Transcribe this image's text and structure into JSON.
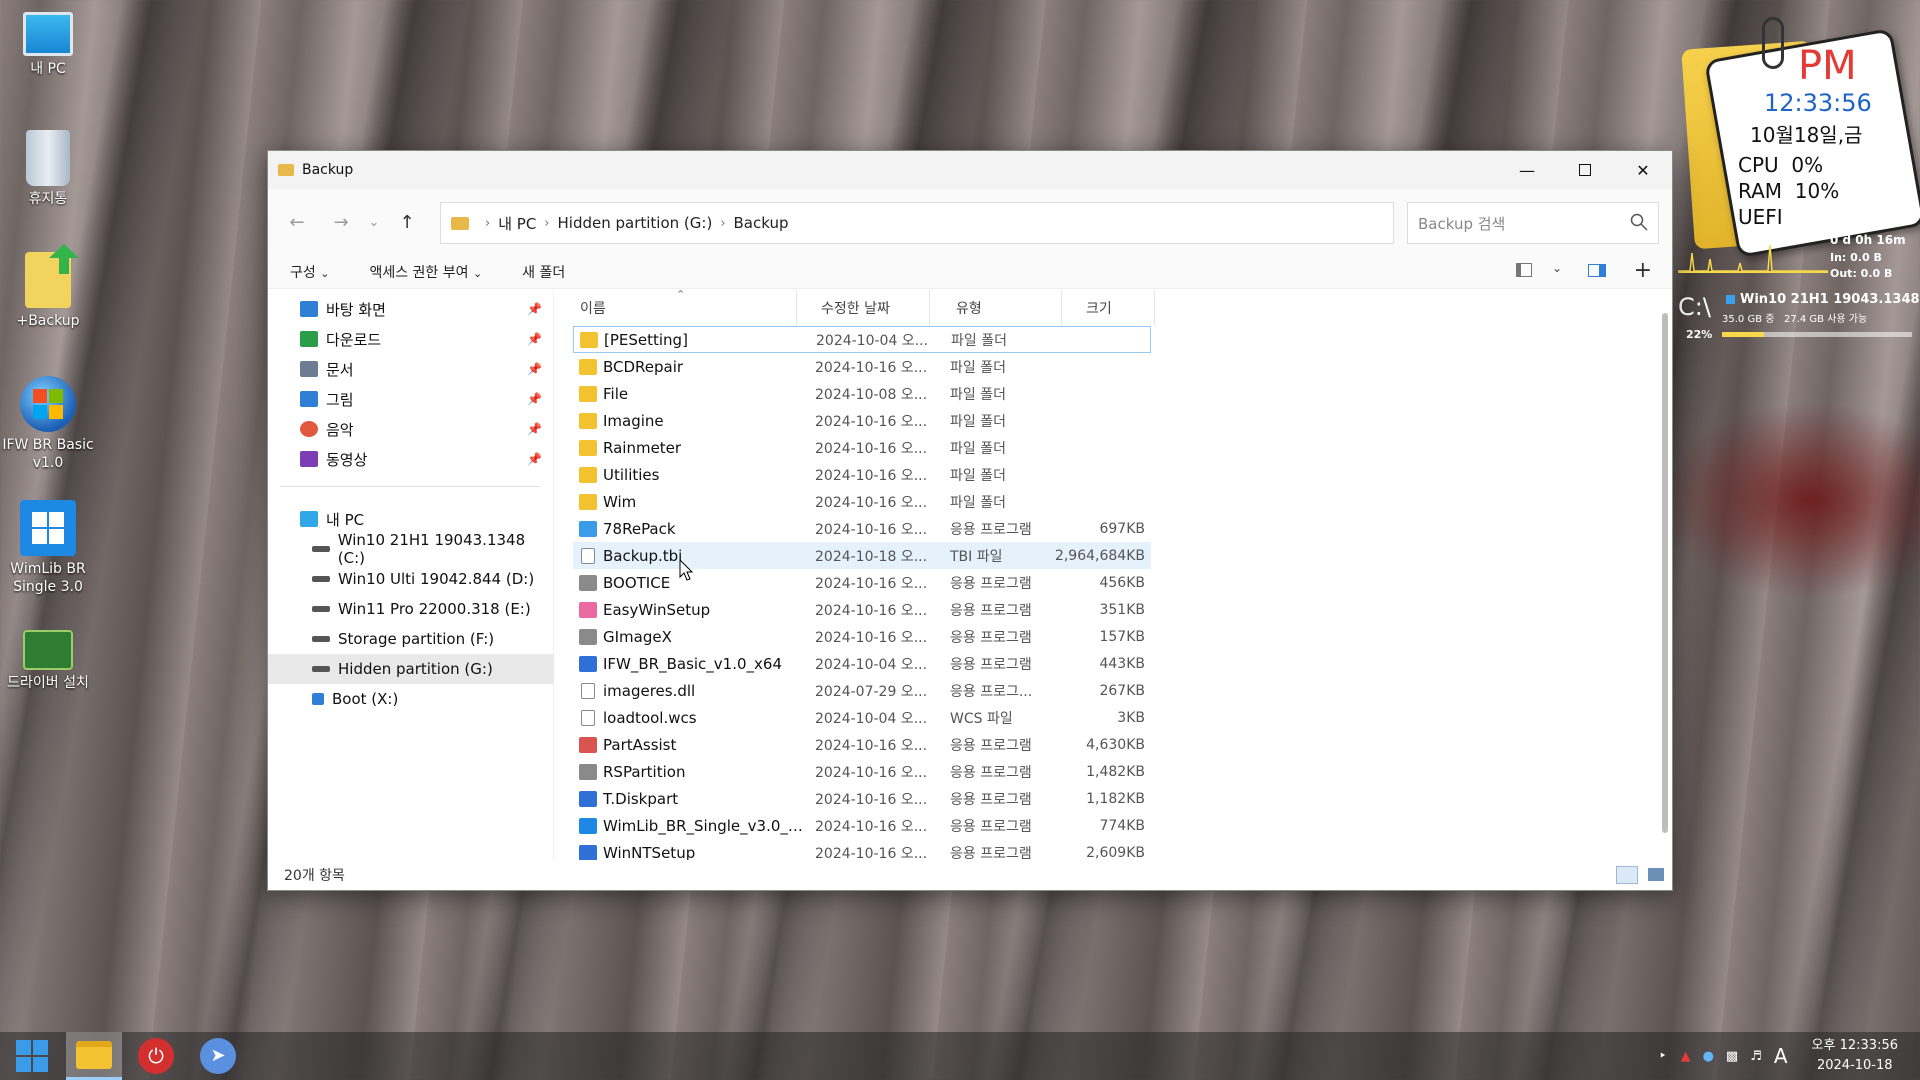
{
  "desktop": {
    "icons": [
      {
        "label": "내 PC"
      },
      {
        "label": "휴지통"
      },
      {
        "label": "+Backup"
      },
      {
        "label": "IFW BR Basic v1.0"
      },
      {
        "label": "WimLib BR Single 3.0"
      },
      {
        "label": "드라이버 설치"
      }
    ]
  },
  "window": {
    "title": "Backup",
    "breadcrumb": [
      "내 PC",
      "Hidden partition (G:)",
      "Backup"
    ],
    "search_placeholder": "Backup 검색",
    "commands": {
      "organize": "구성",
      "share": "액세스 권한 부여",
      "new_folder": "새 폴더"
    },
    "nav": {
      "quick": [
        {
          "label": "바탕 화면",
          "color": "#2f7fd6"
        },
        {
          "label": "다운로드",
          "color": "#2a9d4b"
        },
        {
          "label": "문서",
          "color": "#6b7c93"
        },
        {
          "label": "그림",
          "color": "#2f7fd6"
        },
        {
          "label": "음악",
          "color": "#e0583e"
        },
        {
          "label": "동영상",
          "color": "#7b3fb3"
        }
      ],
      "thispc": "내 PC",
      "drives": [
        "Win10 21H1 19043.1348 (C:)",
        "Win10 Ulti 19042.844 (D:)",
        "Win11 Pro 22000.318 (E:)",
        "Storage partition (F:)",
        "Hidden partition (G:)",
        "Boot (X:)"
      ]
    },
    "columns": {
      "name": "이름",
      "date": "수정한 날짜",
      "type": "유형",
      "size": "크기"
    },
    "files": [
      {
        "name": "[PESetting]",
        "date": "2024-10-04 오...",
        "type": "파일 폴더",
        "size": "",
        "icon": "folder"
      },
      {
        "name": "BCDRepair",
        "date": "2024-10-16 오...",
        "type": "파일 폴더",
        "size": "",
        "icon": "folder"
      },
      {
        "name": "File",
        "date": "2024-10-08 오...",
        "type": "파일 폴더",
        "size": "",
        "icon": "folder"
      },
      {
        "name": "Imagine",
        "date": "2024-10-16 오...",
        "type": "파일 폴더",
        "size": "",
        "icon": "folder"
      },
      {
        "name": "Rainmeter",
        "date": "2024-10-16 오...",
        "type": "파일 폴더",
        "size": "",
        "icon": "folder"
      },
      {
        "name": "Utilities",
        "date": "2024-10-16 오...",
        "type": "파일 폴더",
        "size": "",
        "icon": "folder"
      },
      {
        "name": "Wim",
        "date": "2024-10-16 오...",
        "type": "파일 폴더",
        "size": "",
        "icon": "folder"
      },
      {
        "name": "78RePack",
        "date": "2024-10-16 오...",
        "type": "응용 프로그램",
        "size": "697KB",
        "icon": "app-tri"
      },
      {
        "name": "Backup.tbi",
        "date": "2024-10-18 오...",
        "type": "TBI 파일",
        "size": "2,964,684KB",
        "icon": "file"
      },
      {
        "name": "BOOTICE",
        "date": "2024-10-16 오...",
        "type": "응용 프로그램",
        "size": "456KB",
        "icon": "app-gray"
      },
      {
        "name": "EasyWinSetup",
        "date": "2024-10-16 오...",
        "type": "응용 프로그램",
        "size": "351KB",
        "icon": "app-pink"
      },
      {
        "name": "GImageX",
        "date": "2024-10-16 오...",
        "type": "응용 프로그램",
        "size": "157KB",
        "icon": "app-gray"
      },
      {
        "name": "IFW_BR_Basic_v1.0_x64",
        "date": "2024-10-04 오...",
        "type": "응용 프로그램",
        "size": "443KB",
        "icon": "app-blue"
      },
      {
        "name": "imageres.dll",
        "date": "2024-07-29 오...",
        "type": "응용 프로그...",
        "size": "267KB",
        "icon": "file"
      },
      {
        "name": "loadtool.wcs",
        "date": "2024-10-04 오...",
        "type": "WCS 파일",
        "size": "3KB",
        "icon": "file"
      },
      {
        "name": "PartAssist",
        "date": "2024-10-16 오...",
        "type": "응용 프로그램",
        "size": "4,630KB",
        "icon": "app-multi"
      },
      {
        "name": "RSPartition",
        "date": "2024-10-16 오...",
        "type": "응용 프로그램",
        "size": "1,482KB",
        "icon": "app-gray"
      },
      {
        "name": "T.Diskpart",
        "date": "2024-10-16 오...",
        "type": "응용 프로그램",
        "size": "1,182KB",
        "icon": "app-blue"
      },
      {
        "name": "WimLib_BR_Single_v3.0_Dra...",
        "date": "2024-10-16 오...",
        "type": "응용 프로그램",
        "size": "774KB",
        "icon": "app-win"
      },
      {
        "name": "WinNTSetup",
        "date": "2024-10-16 오...",
        "type": "응용 프로그램",
        "size": "2,609KB",
        "icon": "app-blue"
      }
    ],
    "status": "20개 항목"
  },
  "gadget": {
    "ampm": "PM",
    "time": "12:33:56",
    "date": "10월18일,금",
    "cpu": "CPU  0%",
    "ram": "RAM  10%",
    "boot": "UEFI",
    "uptime": "0 d 0h 16m",
    "net_in": "In: 0.0 B",
    "net_out": "Out: 0.0 B",
    "drive_letter": "C:\\",
    "drive_name": "Win10 21H1 19043.1348",
    "drive_space": "35.0 GB 중   27.4 GB 사용 가능",
    "drive_pct": "22%",
    "drive_fraction": 0.22
  },
  "taskbar": {
    "clock_time": "오후 12:33:56",
    "clock_date": "2024-10-18",
    "ime": "A"
  },
  "colors": {
    "folder": "#e8b84a",
    "accent": "#0063b1"
  }
}
